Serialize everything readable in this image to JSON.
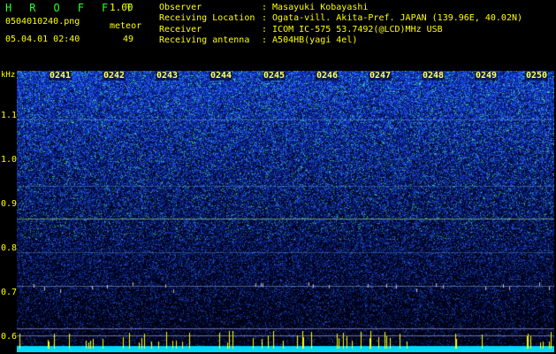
{
  "app": {
    "title": "H R O F F T",
    "version": "1.00",
    "filename": "0504010240.png",
    "meteor_label": "meteor",
    "datetime": "05.04.01 02:40",
    "meteor_count": "49"
  },
  "station": [
    {
      "label": "Observer",
      "value": ": Masayuki Kobayashi"
    },
    {
      "label": "Receiving Location",
      "value": ": Ogata-vill. Akita-Pref. JAPAN (139.96E, 40.02N)"
    },
    {
      "label": "Receiver",
      "value": ": ICOM IC-575 53.7492(@LCD)MHz USB"
    },
    {
      "label": "Receiving antenna",
      "value": ": A504HB(yagi 4el)"
    }
  ],
  "spectrogram": {
    "y_unit": "kHz",
    "y_ticks": [
      "1.1",
      "1.0",
      "0.9",
      "0.8",
      "0.7",
      "0.6"
    ],
    "x_ticks": [
      "0241",
      "0242",
      "0243",
      "0244",
      "0245",
      "0246",
      "0247",
      "0248",
      "0249",
      "0250"
    ],
    "colors": {
      "background": "#000000",
      "noise_low": "#00187a",
      "noise_high": "#3c78ff",
      "signal": "#ffff00",
      "baseline": "#00e0ff"
    }
  }
}
